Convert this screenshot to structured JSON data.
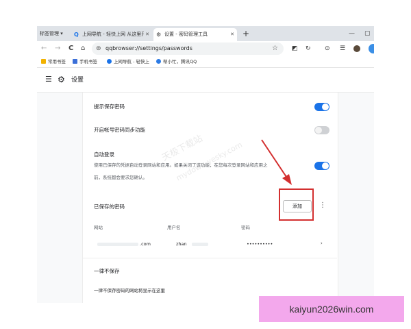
{
  "browser": {
    "tab_group_label": "标签管理",
    "tab_group_arrow": "▾",
    "tabs": [
      {
        "icon": "Q",
        "title": "上网导航 - 轻快上网 从这里开始",
        "close": "✕"
      },
      {
        "icon": "⚙",
        "title": "设置 - 密码管理工具",
        "close": "✕"
      }
    ],
    "new_tab": "+",
    "window_controls": [
      "—",
      "▢"
    ],
    "nav": {
      "back": "←",
      "forward": "→",
      "reload": "C",
      "home": "⌂"
    },
    "address": "qqbrowser://settings/passwords",
    "search_glyph": "⊜",
    "bookmark_star": "☆",
    "toolbar_icons": [
      "◩",
      "↻",
      "⊙",
      "☰"
    ],
    "toolbar_icon_names": [
      "screenshot-icon",
      "sync-icon",
      "history-icon",
      "menu-icon"
    ],
    "bookmarks": [
      {
        "label": "常用书签",
        "color": "#f2b200"
      },
      {
        "label": "手机书签",
        "color": "#3b6fd8"
      },
      {
        "label": "上网导航 - 轻快上",
        "color": "#1a73e8"
      },
      {
        "label": "帮小忙，腾讯QQ",
        "color": "#2c7be5"
      }
    ]
  },
  "settings": {
    "menu_glyph": "☰",
    "gear_glyph": "⚙",
    "title": "设置",
    "offer_save_label": "提示保存密码",
    "account_sync_label": "开启帐号密码同步功能",
    "auto_signin_label": "自动登录",
    "auto_signin_desc_line1": "使用已保存的凭据自动登录网站和应用。如果关闭了该功能，在您每次登录网站和应用之",
    "auto_signin_desc_line2": "前，系统都会要求您确认。",
    "toggles": {
      "offer_save": true,
      "account_sync": false,
      "auto_signin": true
    },
    "saved_passwords_label": "已保存的密码",
    "add_button": "添加",
    "more_glyph": "⋮",
    "columns": {
      "site": "网站",
      "username": "用户名",
      "password": "密码"
    },
    "entry": {
      "site": ".com",
      "username": "zhan",
      "password": "••••••••••",
      "chevron": "›"
    },
    "never_saved_label": "一律不保存",
    "never_saved_desc": "一律不保存密码的网站将显示在这里"
  },
  "watermark": {
    "line1": "天极下载站",
    "line2": "mydown.yesky.com"
  },
  "banner": {
    "text": "kaiyun2026win.com"
  },
  "colors": {
    "toggle_on": "#1a73e8",
    "toggle_off": "#cfd1d4",
    "highlight": "#d32f2f",
    "banner": "#f3a8ec"
  }
}
